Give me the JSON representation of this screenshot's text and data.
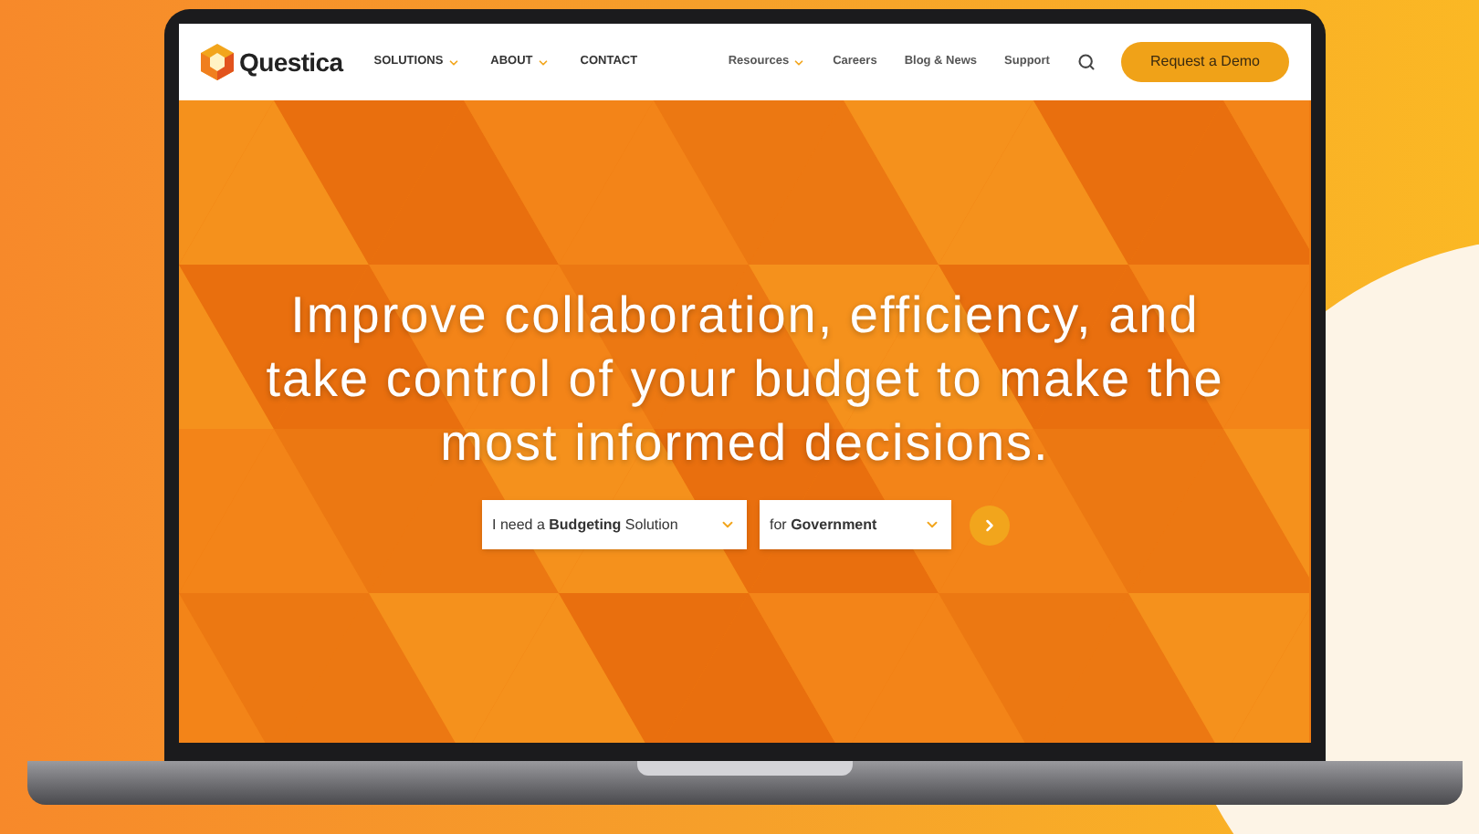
{
  "nav": {
    "logo": "Questica",
    "primary": [
      {
        "label": "SOLUTIONS",
        "dropdown": true
      },
      {
        "label": "ABOUT",
        "dropdown": true
      },
      {
        "label": "CONTACT",
        "dropdown": false
      }
    ],
    "secondary": [
      {
        "label": "Resources",
        "dropdown": true
      },
      {
        "label": "Careers",
        "dropdown": false
      },
      {
        "label": "Blog & News",
        "dropdown": false
      },
      {
        "label": "Support",
        "dropdown": false
      }
    ],
    "cta": "Request a Demo"
  },
  "hero": {
    "headline": [
      "Improve collaboration, efficiency, and",
      "take control of your budget to make the",
      "most informed decisions."
    ],
    "selects": [
      "I need a **Budgeting** Solution",
      "for **Government**"
    ]
  }
}
